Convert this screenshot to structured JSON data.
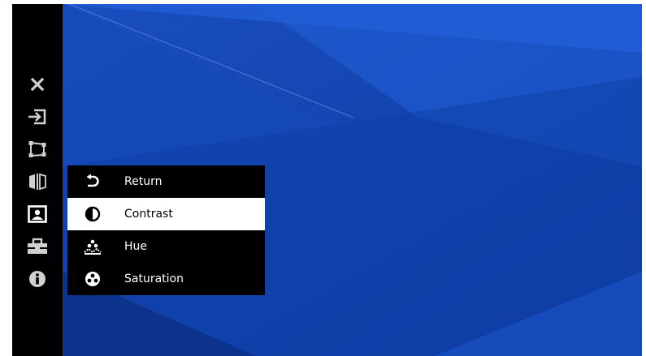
{
  "colors": {
    "sidebar_bg": "#000000",
    "icon_color": "#d0d0d0",
    "icon_active": "#ffffff",
    "menu_bg": "#000000",
    "selected_bg": "#ffffff",
    "wallpaper_blue": "#1246b0"
  },
  "sidebar": {
    "items": [
      {
        "icon": "close-icon",
        "active": false
      },
      {
        "icon": "input-icon",
        "active": false
      },
      {
        "icon": "screen-frame-icon",
        "active": false
      },
      {
        "icon": "mirror-icon",
        "active": false
      },
      {
        "icon": "picture-icon",
        "active": true
      },
      {
        "icon": "toolbox-icon",
        "active": false
      },
      {
        "icon": "info-icon",
        "active": false
      }
    ]
  },
  "menu": {
    "items": [
      {
        "label": "Return",
        "icon": "return-icon",
        "selected": false
      },
      {
        "label": "Contrast",
        "icon": "contrast-icon",
        "selected": true
      },
      {
        "label": "Hue",
        "icon": "hue-icon",
        "selected": false
      },
      {
        "label": "Saturation",
        "icon": "saturation-icon",
        "selected": false
      }
    ]
  }
}
